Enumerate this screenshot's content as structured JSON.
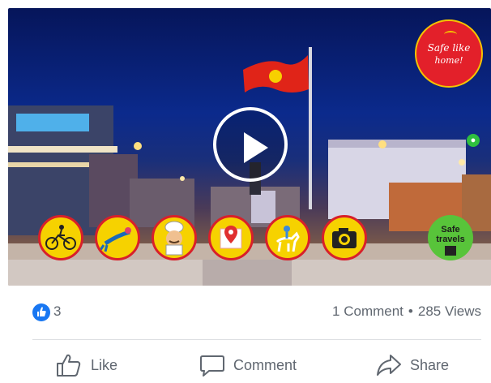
{
  "video": {
    "badge_line1": "Safe like",
    "badge_line2": "home!",
    "safe_travels_line1": "Safe",
    "safe_travels_line2": "travels",
    "topic_icons": [
      "cycling-icon",
      "diving-icon",
      "chef-icon",
      "map-pin-icon",
      "horse-rider-icon",
      "camera-icon"
    ]
  },
  "stats": {
    "reaction_count": "3",
    "comments": "1 Comment",
    "separator": "•",
    "views": "285 Views"
  },
  "actions": {
    "like": "Like",
    "comment": "Comment",
    "share": "Share"
  },
  "colors": {
    "facebook_blue": "#1877f2",
    "badge_red": "#e3202a",
    "icon_yellow": "#f6d200",
    "safe_green": "#58c43a"
  }
}
